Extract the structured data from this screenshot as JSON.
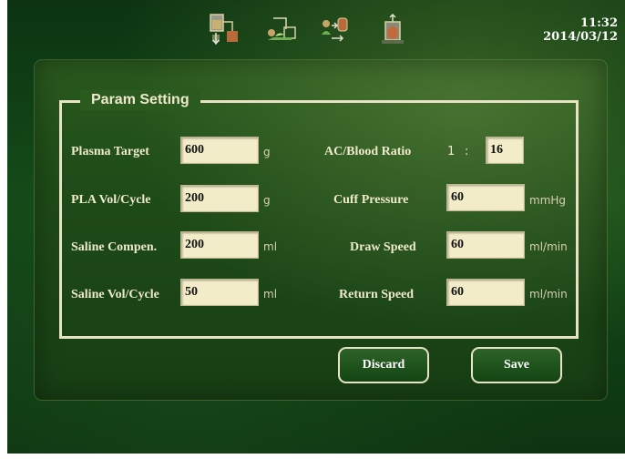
{
  "header": {
    "time": "11:32",
    "date": "2014/03/12",
    "toolbar_icons": [
      "separator-bag-icon",
      "patient-donor-icon",
      "cell-processing-icon",
      "collection-bag-icon"
    ]
  },
  "panel": {
    "title": "Param Setting",
    "left_fields": [
      {
        "label": "Plasma Target",
        "value": "600",
        "unit": "g"
      },
      {
        "label": "PLA Vol/Cycle",
        "value": "200",
        "unit": "g"
      },
      {
        "label": "Saline Compen.",
        "value": "200",
        "unit": "ml"
      },
      {
        "label": "Saline Vol/Cycle",
        "value": "50",
        "unit": "ml"
      }
    ],
    "ratio": {
      "label": "AC/Blood Ratio",
      "prefix": "1",
      "separator": ":",
      "value": "16"
    },
    "right_fields": [
      {
        "label": "Cuff Pressure",
        "value": "60",
        "unit": "mmHg"
      },
      {
        "label": "Draw Speed",
        "value": "60",
        "unit": "ml/min"
      },
      {
        "label": "Return Speed",
        "value": "60",
        "unit": "ml/min"
      }
    ]
  },
  "buttons": {
    "discard": "Discard",
    "save": "Save"
  },
  "colors": {
    "background": "#134a18",
    "field": "#f2ecc8",
    "label": "#efe9cc",
    "border": "#e8e2c4"
  }
}
